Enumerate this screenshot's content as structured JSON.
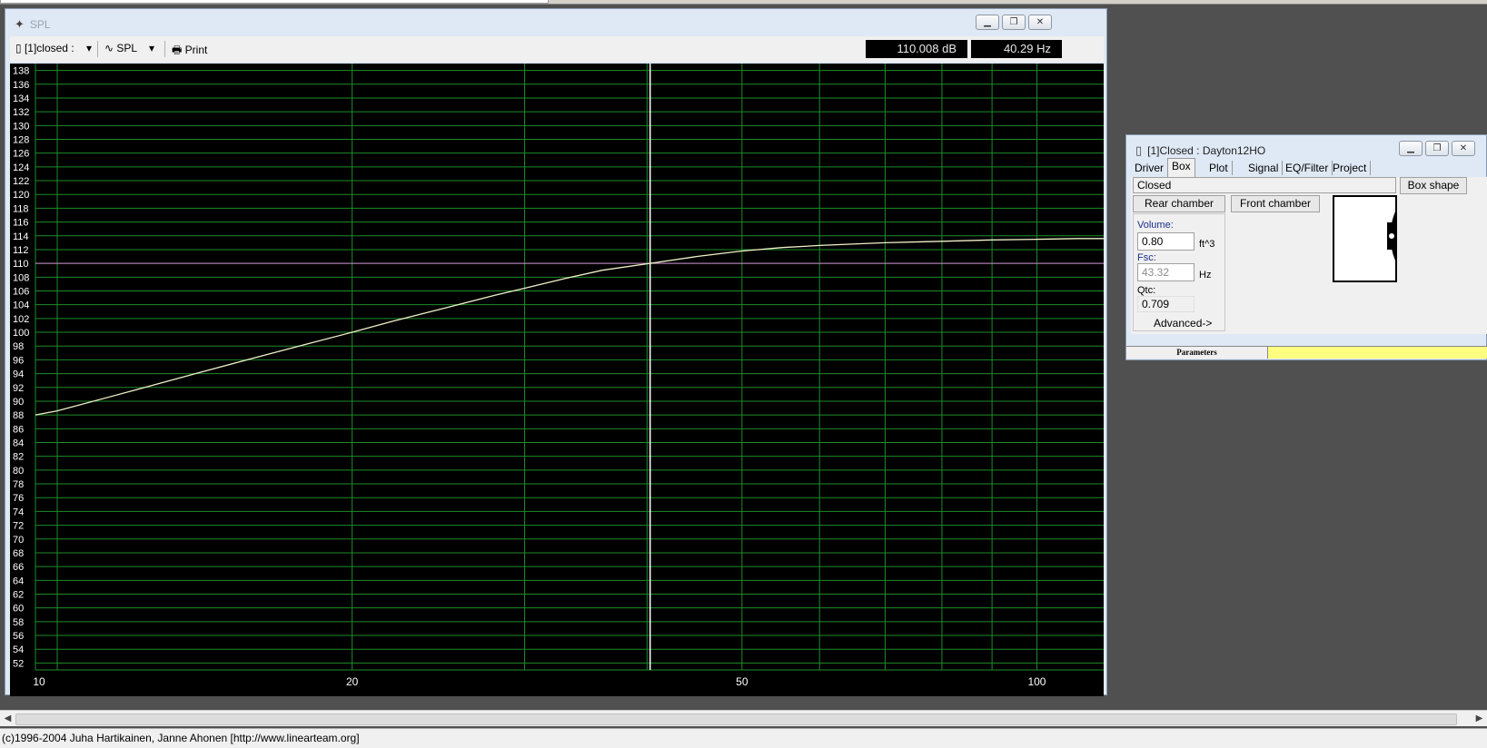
{
  "spl_window": {
    "title": "SPL",
    "project_selector": "[1]closed :",
    "plot_selector": "SPL",
    "print_label": "Print",
    "readout_db": "110.008 dB",
    "readout_hz": "40.29 Hz"
  },
  "chart_data": {
    "type": "line",
    "x_scale": "log",
    "xlim": [
      9.5,
      117
    ],
    "ylim": [
      51,
      139
    ],
    "x_ticks": [
      "10",
      "20",
      "50",
      "100"
    ],
    "y_ticks": [
      "52",
      "54",
      "56",
      "58",
      "60",
      "62",
      "64",
      "66",
      "68",
      "70",
      "72",
      "74",
      "76",
      "78",
      "80",
      "82",
      "84",
      "86",
      "88",
      "90",
      "92",
      "94",
      "96",
      "98",
      "100",
      "102",
      "104",
      "106",
      "108",
      "110",
      "112",
      "114",
      "116",
      "118",
      "120",
      "122",
      "124",
      "126",
      "128",
      "130",
      "132",
      "134",
      "136",
      "138"
    ],
    "grid": true,
    "cursor_x": 40.29,
    "cursor_y": 110.008,
    "colors": {
      "background": "#000000",
      "grid": "#1e8c2a",
      "curve": "#f0f0c8",
      "cursor_h": "#d080d0",
      "cursor_v": "#ffffff"
    },
    "series": [
      {
        "x": [
          9.5,
          10,
          12,
          14,
          16,
          18,
          20,
          22,
          25,
          28,
          30,
          33,
          36,
          40.29,
          45,
          50,
          55,
          60,
          70,
          80,
          90,
          100,
          110,
          117
        ],
        "y": [
          88.0,
          88.6,
          91.6,
          94.2,
          96.4,
          98.3,
          100.0,
          101.6,
          103.6,
          105.4,
          106.4,
          107.8,
          109.0,
          110.0,
          111.0,
          111.8,
          112.3,
          112.6,
          113.0,
          113.2,
          113.4,
          113.5,
          113.6,
          113.6
        ]
      }
    ]
  },
  "box_window": {
    "title": "[1]Closed : Dayton12HO",
    "tabs": [
      "Driver",
      "Box",
      "Plot",
      "Signal",
      "EQ/Filter",
      "Project"
    ],
    "box_type": "Closed",
    "box_shape_label": "Box shape",
    "rear_chamber_label": "Rear chamber",
    "front_chamber_label": "Front chamber",
    "volume_label": "Volume:",
    "volume_value": "0.80",
    "volume_unit": "ft^3",
    "fsc_label": "Fsc:",
    "fsc_value": "43.32",
    "fsc_unit": "Hz",
    "qtc_label": "Qtc:",
    "qtc_value": "0.709",
    "advanced_label": "Advanced->",
    "status_label": "Parameters"
  },
  "statusbar": {
    "copyright": "(c)1996-2004 Juha Hartikainen, Janne Ahonen [http://www.linearteam.org]"
  }
}
